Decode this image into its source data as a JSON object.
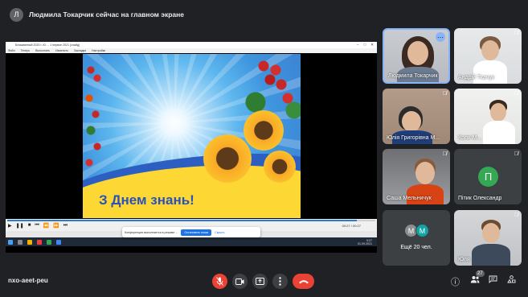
{
  "banner": {
    "avatar_letter": "Л",
    "text": "Людмила Токарчик сейчас на главном экране"
  },
  "shared_screen": {
    "window_title": "Безымянный 2020 г.-Ю ... 1 первое 2021 (слайд)",
    "menu": [
      "Файл",
      "Теперь",
      "Выполнить",
      "Изменить",
      "Закладки",
      "Настройки"
    ],
    "slide_text": "З Днем знань!",
    "player": {
      "elapsed": "00:27",
      "total": "00:27",
      "progress": 0.95,
      "status": "Воспроизвести"
    },
    "taskbar_clock": {
      "time": "9:27",
      "date": "01.09.2021"
    },
    "share_notice": {
      "text": "Конференция выполняется в режиме ...",
      "stop_label": "Остановить показ",
      "hide_label": "Скрыть"
    }
  },
  "participants": [
    {
      "name": "Людмила Токарчик",
      "active": true,
      "muted": false
    },
    {
      "name": "Андрій Ткачук",
      "muted": true
    },
    {
      "name": "Юлія Григорівна М...",
      "muted": true
    },
    {
      "name": "Коля М...",
      "muted": true
    },
    {
      "name": "Саша Мельничук",
      "muted": true
    },
    {
      "name": "Пітик Олександр",
      "muted": true,
      "avatar_letter": "П",
      "avatar_color": "#34a853"
    },
    {
      "name": "Юля",
      "muted": true
    }
  ],
  "others_tile": {
    "avatars": [
      {
        "letter": "М",
        "color": "#8e8e8e"
      },
      {
        "letter": "M",
        "color": "#12a4a4"
      }
    ],
    "label": "Ещё 20 чел."
  },
  "bottom_bar": {
    "meeting_code": "nxo-aeet-peu",
    "participant_count": "27",
    "controls": [
      "mic-off",
      "camera",
      "present",
      "more",
      "hang-up"
    ],
    "right_icons": [
      "info",
      "people",
      "chat",
      "activities"
    ]
  },
  "colors": {
    "background": "#202124",
    "tile": "#3c4043",
    "danger": "#ea4335",
    "accent": "#8ab4f8",
    "slide_text": "#2a52b8"
  }
}
